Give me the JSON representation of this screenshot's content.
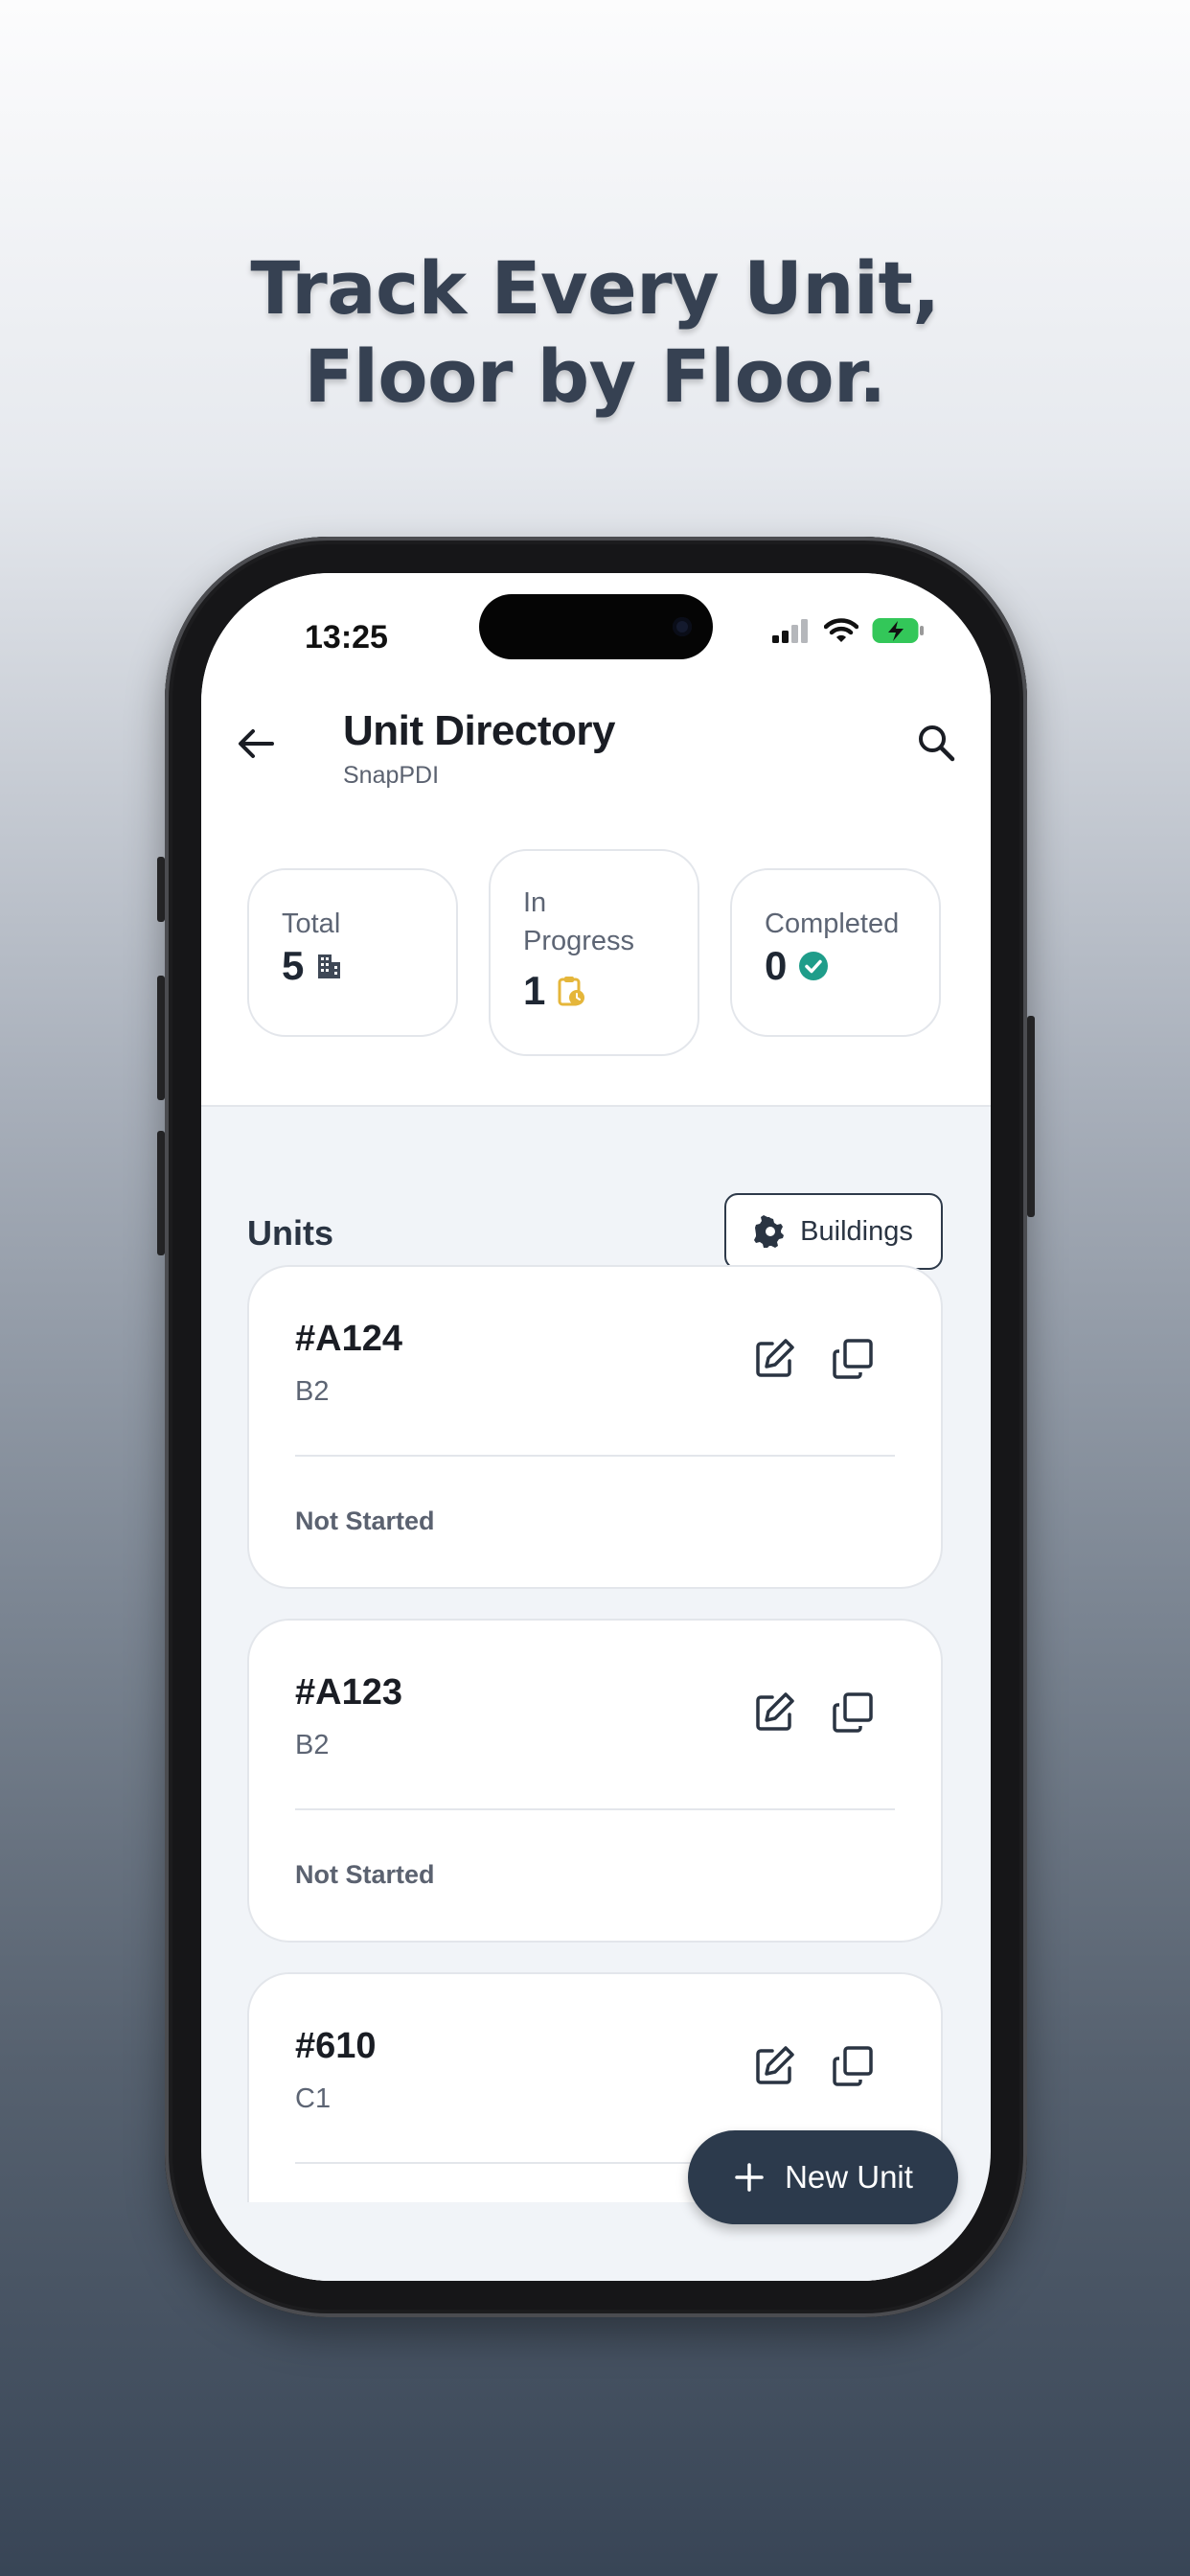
{
  "headline": {
    "line1": "Track Every Unit,",
    "line2": "Floor by Floor."
  },
  "status_bar": {
    "time": "13:25",
    "icons": [
      "signal-icon",
      "wifi-icon",
      "battery-charging-icon"
    ]
  },
  "app_bar": {
    "title": "Unit Directory",
    "subtitle": "SnapPDI",
    "back_icon": "arrow-left-icon",
    "search_icon": "search-icon"
  },
  "stats": [
    {
      "label": "Total",
      "value": "5",
      "icon": "building-icon"
    },
    {
      "label": "In Progress",
      "value": "1",
      "icon": "clipboard-clock-icon"
    },
    {
      "label": "Completed",
      "value": "0",
      "icon": "check-circle-icon"
    }
  ],
  "units_section": {
    "label": "Units",
    "buildings_button": "Buildings"
  },
  "units": [
    {
      "unit": "#A124",
      "building": "B2",
      "status": "Not Started"
    },
    {
      "unit": "#A123",
      "building": "B2",
      "status": "Not Started"
    },
    {
      "unit": "#610",
      "building": "C1",
      "status": ""
    }
  ],
  "fab": {
    "label": "New Unit",
    "icon": "plus-icon"
  },
  "colors": {
    "accent_dark": "#2c3a4c",
    "in_progress": "#e5b63a",
    "completed": "#1f9d8a",
    "screen_bg": "#f1f4f8"
  }
}
